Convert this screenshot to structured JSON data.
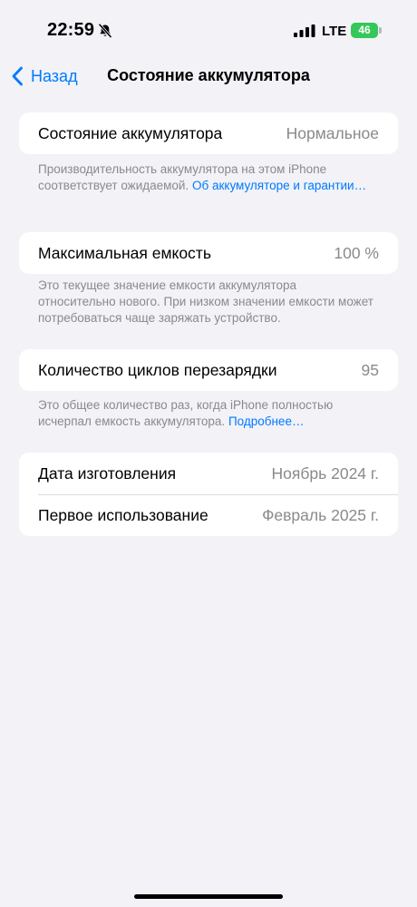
{
  "status_bar": {
    "time": "22:59",
    "network": "LTE",
    "battery": "46"
  },
  "nav": {
    "back_label": "Назад",
    "title": "Состояние аккумулятора"
  },
  "sections": {
    "health": {
      "label": "Состояние аккумулятора",
      "value": "Нормальное",
      "footnote": "Производительность аккумулятора на этом iPhone соответствует ожидаемой.",
      "footnote_link": "Об аккумуляторе и гаран­тии…"
    },
    "capacity": {
      "label": "Максимальная емкость",
      "value": "100 %",
      "footnote": "Это текущее значение емкости аккумулятора относительно нового. При низком значении емкости может потребоваться чаще заряжать устройство."
    },
    "cycles": {
      "label": "Количество циклов перезарядки",
      "value": "95",
      "footnote": "Это общее количество раз, когда iPhone полностью исчерпал емкость аккумулятора.",
      "footnote_link": "Подробнее…"
    },
    "dates": {
      "manufacture_label": "Дата изготовления",
      "manufacture_value": "Ноябрь 2024 г.",
      "first_use_label": "Первое использование",
      "first_use_value": "Февраль 2025 г."
    }
  },
  "colors": {
    "background": "#f2f2f7",
    "accent": "#007aff",
    "secondary_text": "#8a8a8e",
    "battery_green": "#34c759"
  }
}
